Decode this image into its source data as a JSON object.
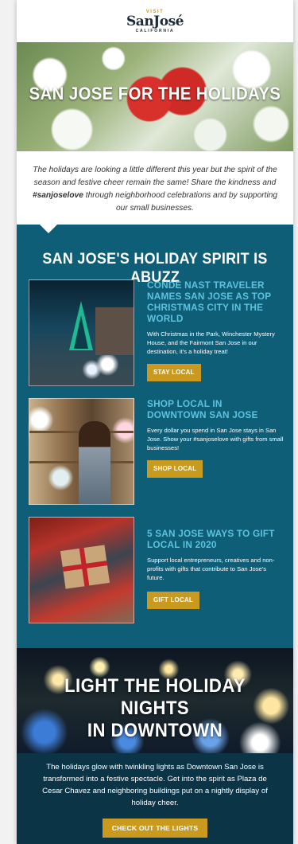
{
  "header": {
    "logo_visit": "VISIT",
    "logo_name": "SanJosé",
    "logo_state": "CALIFORNIA"
  },
  "hero": {
    "title": "SAN JOSE FOR THE HOLIDAYS"
  },
  "intro": {
    "part1": "The holidays are looking a little different this year but the spirit of the season and festive cheer remain the same! Share the kindness and ",
    "hashtag": "#sanjoselove",
    "part2": " through neighborhood celebrations and by supporting our small businesses."
  },
  "section": {
    "title": "SAN JOSE'S HOLIDAY SPIRIT IS ABUZZ",
    "cards": [
      {
        "title": "CONDE NAST TRAVELER NAMES SAN JOSE AS TOP CHRISTMAS CITY IN THE WORLD",
        "description": "With Christmas in the Park, Winchester Mystery House, and the Fairmont San Jose in our destination, it's a holiday treat!",
        "button": "STAY LOCAL"
      },
      {
        "title": "SHOP LOCAL IN DOWNTOWN SAN JOSE",
        "description": "Every dollar you spend in San Jose stays in San Jose. Show your #sanjoselove with gifts from small businesses!",
        "button": "SHOP LOCAL"
      },
      {
        "title": "5 SAN JOSE WAYS  TO GIFT LOCAL IN 2020",
        "description": "Support local entrepreneurs, creatives and non-profits with gifts that contribute to San Jose's future.",
        "button": "GIFT LOCAL"
      }
    ]
  },
  "lights": {
    "title_line1": "LIGHT THE HOLIDAY NIGHTS",
    "title_line2": "IN DOWNTOWN",
    "text": "The holidays glow with twinkling lights as Downtown San Jose is transformed into a festive spectacle. Get into the spirit as Plaza de Cesar Chavez and neighboring buildings put on a nightly display of holiday cheer.",
    "button": "CHECK OUT THE LIGHTS"
  },
  "colors": {
    "teal": "#0e5e78",
    "dark_teal": "#0b3447",
    "gold": "#c99a1e",
    "card_title": "#5cc2de"
  }
}
